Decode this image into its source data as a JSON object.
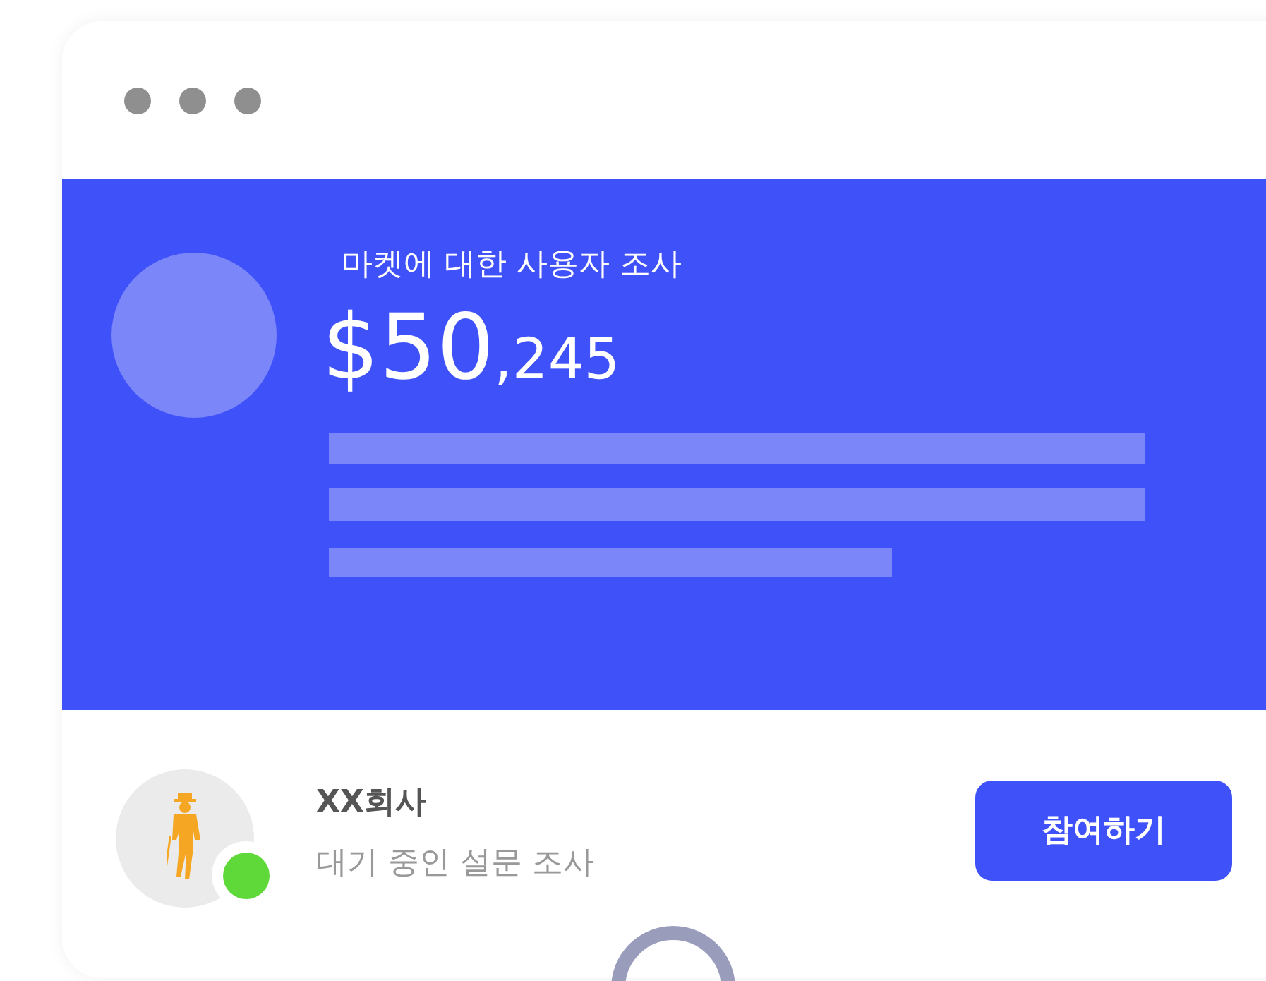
{
  "survey": {
    "title": "마켓에 대한 사용자 조사",
    "amount_main": "$50",
    "amount_sub": ",245"
  },
  "company": {
    "name": "XX회사",
    "status_text": "대기 중인 설문 조사",
    "online": true
  },
  "join_button": {
    "label": "참여하기"
  }
}
